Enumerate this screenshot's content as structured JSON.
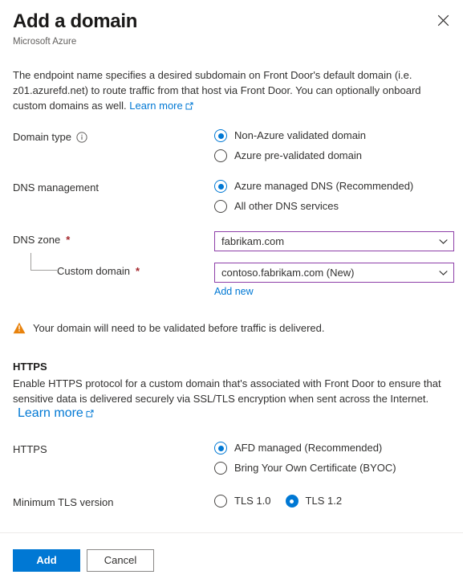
{
  "header": {
    "title": "Add a domain",
    "subtitle": "Microsoft Azure",
    "close_icon": "close-icon"
  },
  "intro": {
    "text": "The endpoint name specifies a desired subdomain on Front Door's default domain (i.e. z01.azurefd.net) to route traffic from that host via Front Door. You can optionally onboard custom domains as well.",
    "link_label": "Learn more",
    "link_icon": "external-link-icon"
  },
  "domain_type": {
    "label": "Domain type",
    "info_icon": "info-circle-icon",
    "options": [
      {
        "label": "Non-Azure validated domain",
        "checked": true
      },
      {
        "label": "Azure pre-validated domain",
        "checked": false
      }
    ]
  },
  "dns_management": {
    "label": "DNS management",
    "options": [
      {
        "label": "Azure managed DNS (Recommended)",
        "checked": true
      },
      {
        "label": "All other DNS services",
        "checked": false
      }
    ]
  },
  "dns_zone": {
    "label": "DNS zone",
    "required_marker": "*",
    "value": "fabrikam.com",
    "chevron_icon": "chevron-down-icon"
  },
  "custom_domain": {
    "label": "Custom domain",
    "required_marker": "*",
    "value": "contoso.fabrikam.com (New)",
    "chevron_icon": "chevron-down-icon",
    "add_new_label": "Add new"
  },
  "warning": {
    "icon": "warning-triangle-icon",
    "text": "Your domain will need to be validated before traffic is delivered.",
    "color": "#e8820c"
  },
  "https_section": {
    "heading": "HTTPS",
    "description": "Enable HTTPS protocol for a custom domain that's associated with Front Door to ensure that sensitive data is delivered securely via SSL/TLS encryption when sent across the Internet.",
    "link_label": "Learn more",
    "link_icon": "external-link-icon"
  },
  "https_field": {
    "label": "HTTPS",
    "options": [
      {
        "label": "AFD managed (Recommended)",
        "checked": true
      },
      {
        "label": "Bring Your Own Certificate (BYOC)",
        "checked": false
      }
    ]
  },
  "tls_field": {
    "label": "Minimum TLS version",
    "options": [
      {
        "label": "TLS 1.0",
        "checked": false
      },
      {
        "label": "TLS 1.2",
        "checked": true
      }
    ]
  },
  "footer": {
    "primary_label": "Add",
    "secondary_label": "Cancel"
  },
  "colors": {
    "accent": "#0078d4",
    "dropdown_border": "#8e3fa8",
    "required": "#a4262c",
    "warning": "#e8820c"
  }
}
